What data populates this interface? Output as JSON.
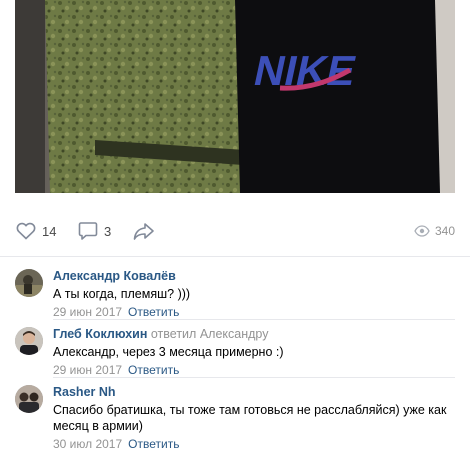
{
  "post": {
    "image_alt": "Two young men, one in camouflage uniform, one in a black t-shirt",
    "shirt_logo": "NIKE",
    "likes": "14",
    "comments": "3",
    "views": "340"
  },
  "comments": [
    {
      "author": "Александр Ковалёв",
      "reply_to_prefix": "",
      "reply_to": "",
      "text": "А ты когда, племяш? )))",
      "date": "29 июн 2017",
      "reply_label": "Ответить"
    },
    {
      "author": "Глеб Коклюхин",
      "reply_to_prefix": "ответил",
      "reply_to": "Александру",
      "text": "Александр, через 3 месяца примерно :)",
      "date": "29 июн 2017",
      "reply_label": "Ответить"
    },
    {
      "author": "Rasher Nh",
      "reply_to_prefix": "",
      "reply_to": "",
      "text": "Спасибо братишка, ты тоже там готовься не расслабляйся) уже как месяц в армии)",
      "date": "30 июл 2017",
      "reply_label": "Ответить"
    }
  ],
  "colors": {
    "link": "#2a5885",
    "meta": "#939393",
    "separator": "#e7e8ec"
  }
}
